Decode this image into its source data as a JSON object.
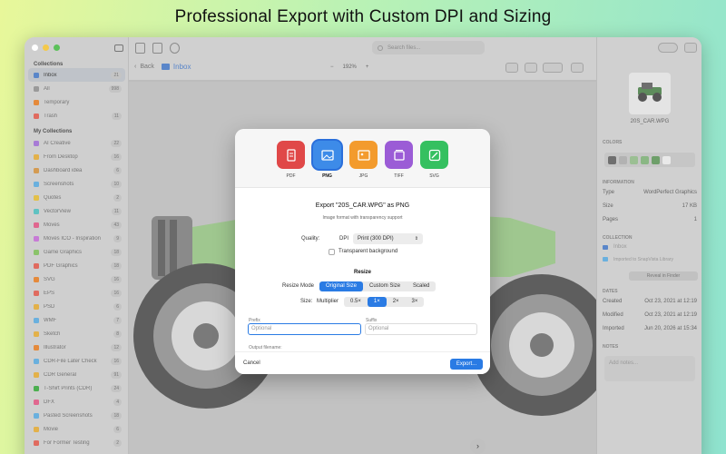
{
  "headline": "Professional Export with Custom DPI and Sizing",
  "toolbar": {
    "search_placeholder": "Search files...",
    "back_label": "Back",
    "folder_label": "Inbox",
    "zoom_level": "192%"
  },
  "sidebar": {
    "collections_heading": "Collections",
    "collections": [
      {
        "label": "Inbox",
        "count": "21",
        "color": "#5a86c9",
        "active": true
      },
      {
        "label": "All",
        "count": "998",
        "color": "#9a9a9a"
      },
      {
        "label": "Temporary",
        "count": "",
        "color": "#e58a3b"
      },
      {
        "label": "Trash",
        "count": "11",
        "color": "#e06b5f"
      }
    ],
    "my_collections_heading": "My Collections",
    "my_collections": [
      {
        "label": "AI Creative",
        "count": "22",
        "color": "#a77bd6"
      },
      {
        "label": "From Desktop",
        "count": "16",
        "color": "#e3b14a"
      },
      {
        "label": "Dashboard idea",
        "count": "6",
        "color": "#d49b52"
      },
      {
        "label": "Screenshots",
        "count": "10",
        "color": "#6ab0de"
      },
      {
        "label": "Quotes",
        "count": "2",
        "color": "#e3c04a"
      },
      {
        "label": "VectorView",
        "count": "11",
        "color": "#5fc2c2"
      },
      {
        "label": "Moves",
        "count": "43",
        "color": "#e0678f"
      },
      {
        "label": "Moves ICO - Inspiration",
        "count": "9",
        "color": "#c77bd6"
      },
      {
        "label": "Game Graphics",
        "count": "18",
        "color": "#8bc36b"
      },
      {
        "label": "PDF Graphics",
        "count": "18",
        "color": "#e06b5f"
      },
      {
        "label": "SVG",
        "count": "16",
        "color": "#e58a3b"
      },
      {
        "label": "EPS",
        "count": "16",
        "color": "#e06b5f"
      },
      {
        "label": "PSD",
        "count": "6",
        "color": "#e3b14a"
      },
      {
        "label": "WMF",
        "count": "7",
        "color": "#6ab0de"
      },
      {
        "label": "Sketch",
        "count": "8",
        "color": "#e3b14a"
      },
      {
        "label": "Illustrator",
        "count": "12",
        "color": "#e58a3b"
      },
      {
        "label": "CDR-File Later Check",
        "count": "16",
        "color": "#6ab0de"
      },
      {
        "label": "CDR General",
        "count": "91",
        "color": "#e3b14a"
      },
      {
        "label": "T-Shirt Prints (CDR)",
        "count": "24",
        "color": "#4caf50"
      },
      {
        "label": "DFX",
        "count": "4",
        "color": "#e0678f"
      },
      {
        "label": "Pasted Screenshots",
        "count": "18",
        "color": "#6ab0de"
      },
      {
        "label": "Movie",
        "count": "6",
        "color": "#e3b14a"
      },
      {
        "label": "For Former Testing",
        "count": "2",
        "color": "#e06b5f"
      }
    ]
  },
  "inspector": {
    "filename": "20S_CAR.WPG",
    "colors_heading": "COLORS",
    "swatch_colors": [
      "#6f6f6f",
      "#b2b2b2",
      "#9bbf93",
      "#8ab784",
      "#6e9f6a",
      "#e9e9e9"
    ],
    "information_heading": "INFORMATION",
    "info": [
      {
        "key": "Type",
        "value": "WordPerfect Graphics"
      },
      {
        "key": "Size",
        "value": "17 KB"
      },
      {
        "key": "Pages",
        "value": "1"
      }
    ],
    "collection_heading": "COLLECTION",
    "collection_inbox": "Inbox",
    "collection_imported": "Imported to SnapVista Library",
    "reveal_label": "Reveal in Finder",
    "dates_heading": "DATES",
    "dates": [
      {
        "key": "Created",
        "value": "Oct 23, 2021 at 12:19"
      },
      {
        "key": "Modified",
        "value": "Oct 23, 2021 at 12:19"
      },
      {
        "key": "Imported",
        "value": "Jun 20, 2026 at 15:34"
      }
    ],
    "notes_heading": "NOTES",
    "notes_placeholder": "Add notes..."
  },
  "modal": {
    "formats": [
      {
        "label": "PDF",
        "color": "#e04848",
        "icon": "pdf-file-icon"
      },
      {
        "label": "PNG",
        "color": "#3d8be8",
        "icon": "image-icon",
        "selected": true
      },
      {
        "label": "JPG",
        "color": "#f39b2d",
        "icon": "photo-icon"
      },
      {
        "label": "TIFF",
        "color": "#9b5cd6",
        "icon": "stack-images-icon"
      },
      {
        "label": "SVG",
        "color": "#35c060",
        "icon": "pen-square-icon"
      }
    ],
    "title": "Export \"20S_CAR.WPG\" as PNG",
    "subtitle": "Image format with transparency support",
    "quality_label": "Quality:",
    "dpi_label": "DPI",
    "dpi_value": "Print (300 DPI)",
    "transparent_label": "Transparent background",
    "resize_heading": "Resize",
    "resize_mode_label": "Resize Mode",
    "resize_modes": [
      "Original Size",
      "Custom Size",
      "Scaled"
    ],
    "resize_mode_selected": 0,
    "size_label": "Size:",
    "multiplier_label": "Multiplier",
    "multipliers": [
      "0.5×",
      "1×",
      "2×",
      "3×"
    ],
    "multiplier_selected": 1,
    "prefix_label": "Prefix",
    "prefix_placeholder": "Optional",
    "suffix_label": "Suffix",
    "suffix_placeholder": "Optional",
    "output_filename_label": "Output filename:",
    "cancel_label": "Cancel",
    "export_label": "Export..."
  }
}
